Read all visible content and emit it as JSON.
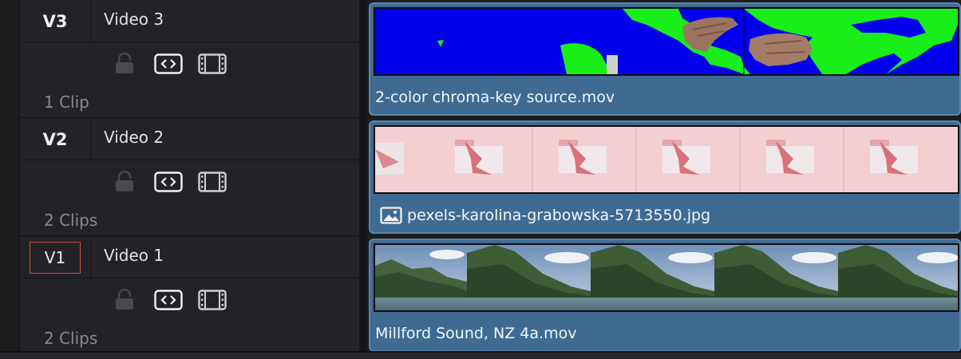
{
  "tracks": [
    {
      "id": "V3",
      "name": "Video 3",
      "clip_count": "1 Clip",
      "selected": false
    },
    {
      "id": "V2",
      "name": "Video 2",
      "clip_count": "2 Clips",
      "selected": false
    },
    {
      "id": "V1",
      "name": "Video 1",
      "clip_count": "2 Clips",
      "selected": true
    }
  ],
  "clips": [
    {
      "track": "V3",
      "filename": "2-color chroma-key source.mov",
      "type": "video"
    },
    {
      "track": "V2",
      "filename": "pexels-karolina-grabowska-5713550.jpg",
      "type": "image"
    },
    {
      "track": "V1",
      "filename": "Millford Sound, NZ 4a.mov",
      "type": "video"
    }
  ],
  "colors": {
    "clip_fill": "#3f6b93",
    "selected_track_outline": "#d34a3e",
    "chroma_blue": "#0000ee",
    "chroma_green": "#19ee19"
  },
  "icons": [
    "lock-icon",
    "auto-select-icon",
    "film-strip-icon",
    "image-icon"
  ]
}
